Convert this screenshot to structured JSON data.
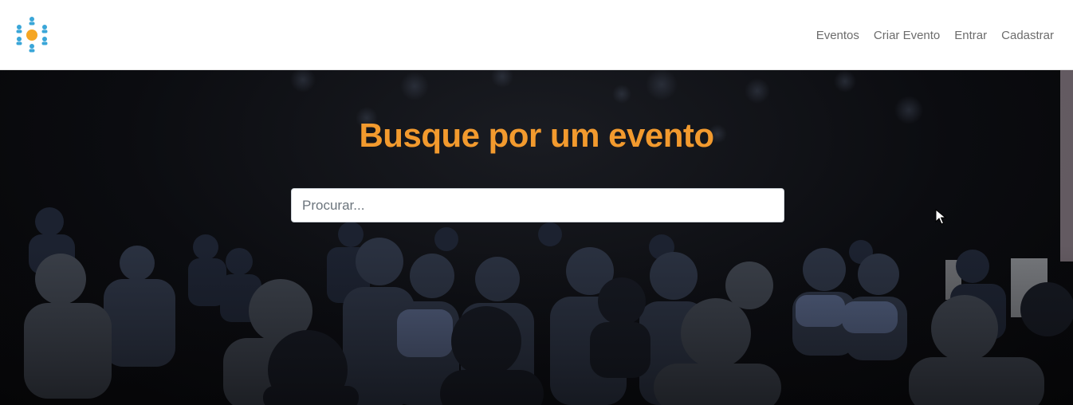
{
  "brand": {
    "logo_icon": "people-network-logo",
    "accent": "#f29a2e",
    "logo_color": "#3aa6d8"
  },
  "nav": {
    "items": [
      {
        "label": "Eventos"
      },
      {
        "label": "Criar Evento"
      },
      {
        "label": "Entrar"
      },
      {
        "label": "Cadastrar"
      }
    ]
  },
  "hero": {
    "title": "Busque por um evento",
    "title_color": "#f29a2e",
    "search": {
      "placeholder": "Procurar...",
      "value": ""
    },
    "background": "audience-photo"
  }
}
